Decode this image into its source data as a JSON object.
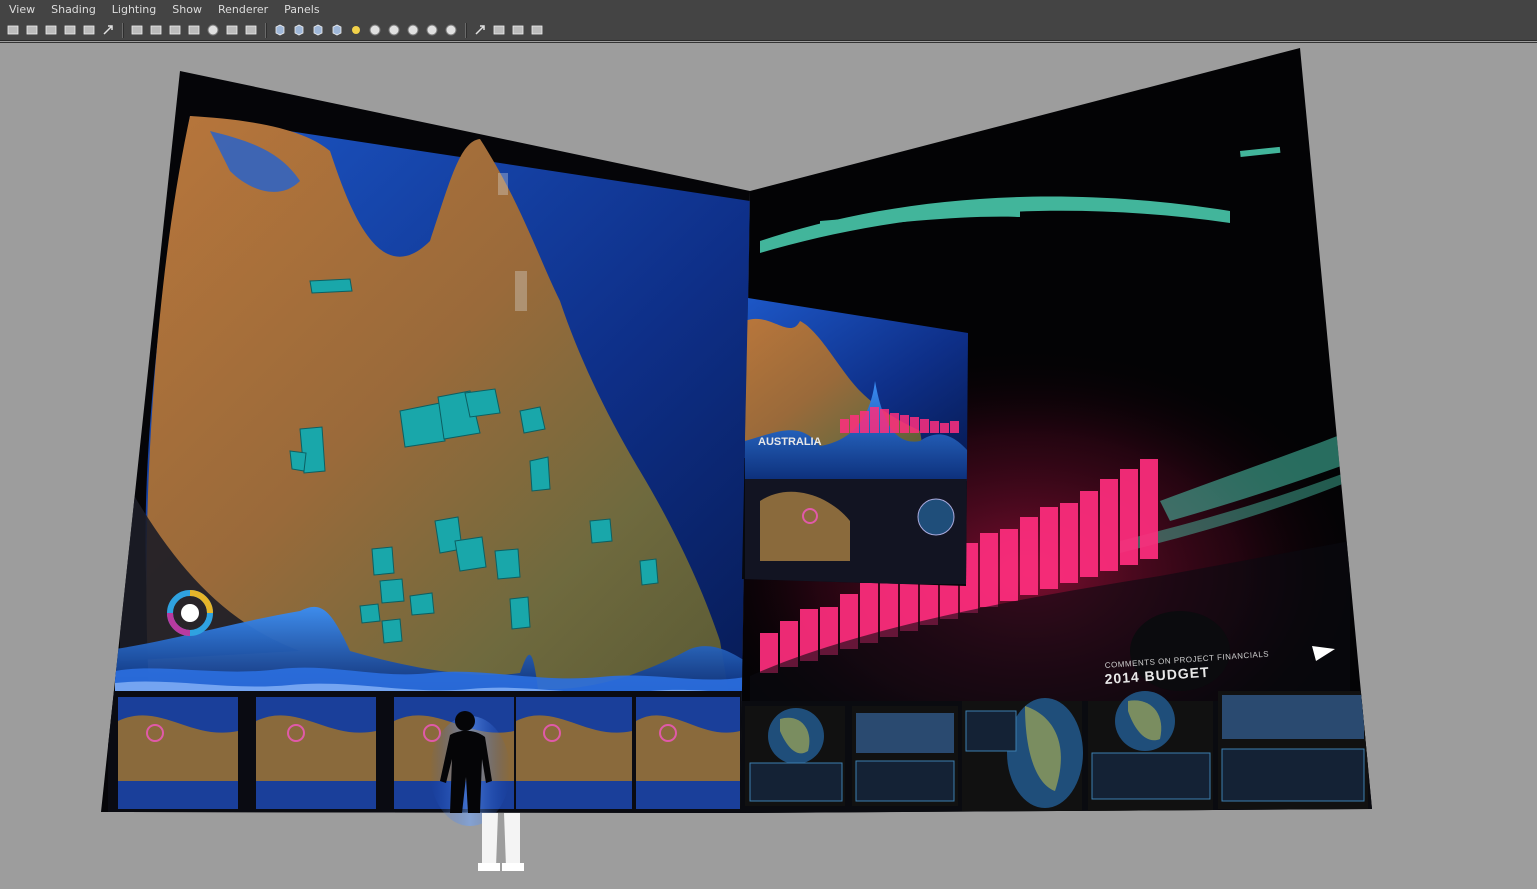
{
  "menu": {
    "items": [
      {
        "label": "View"
      },
      {
        "label": "Shading"
      },
      {
        "label": "Lighting"
      },
      {
        "label": "Show"
      },
      {
        "label": "Renderer"
      },
      {
        "label": "Panels"
      }
    ]
  },
  "toolbar": {
    "groups": [
      [
        "camera-attributes-icon",
        "bookmark-icon",
        "image-plane-icon",
        "2d-pan-zoom-icon",
        "grease-pencil-icon",
        "frame-selected-icon"
      ],
      [
        "grid-icon",
        "film-gate-icon",
        "resolution-gate-icon",
        "gate-mask-icon",
        "field-chart-icon",
        "safe-action-icon",
        "safe-title-icon"
      ],
      [
        "wireframe-icon",
        "smooth-shade-icon",
        "shaded-wireframe-icon",
        "textured-icon",
        "use-all-lights-icon",
        "shadows-icon",
        "screen-space-ao-icon",
        "motion-blur-icon",
        "multisample-aa-icon",
        "depth-of-field-icon"
      ],
      [
        "isolate-select-icon",
        "xray-icon",
        "xray-active-components-icon",
        "xray-joints-icon"
      ]
    ]
  },
  "scene": {
    "screen_text": {
      "budget_subtitle": "COMMENTS ON PROJECT FINANCIALS",
      "budget_title": "2014 BUDGET",
      "inset_label": "AUSTRALIA"
    },
    "colors": {
      "viewport_bg": "#9d9d9d",
      "ui_bg": "#444444",
      "accent_teal": "#1aa8a8",
      "accent_pink": "#ff2d7a",
      "accent_blue": "#2e7bf0"
    }
  }
}
